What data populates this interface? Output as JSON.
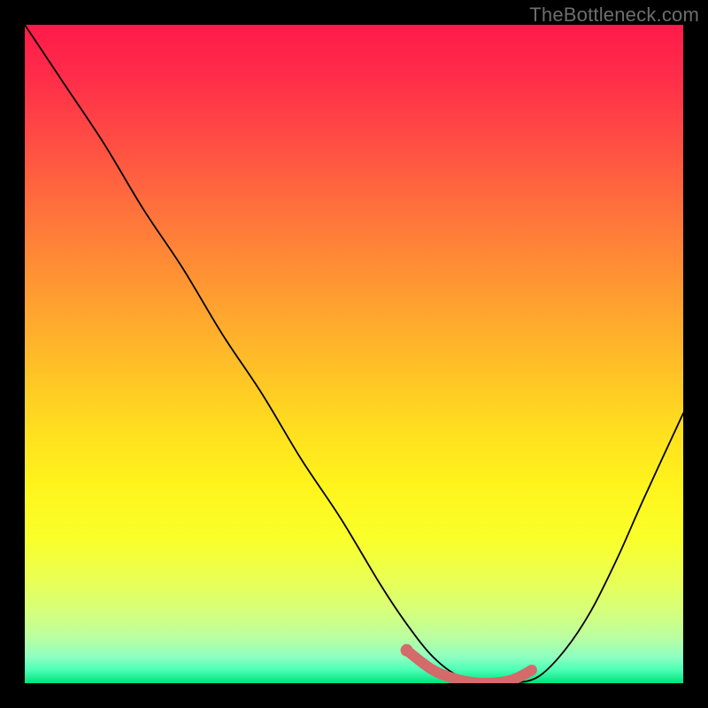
{
  "watermark": "TheBottleneck.com",
  "chart_data": {
    "type": "line",
    "title": "",
    "xlabel": "",
    "ylabel": "",
    "xlim": [
      0,
      100
    ],
    "ylim": [
      0,
      100
    ],
    "grid": false,
    "series": [
      {
        "name": "bottleneck-curve",
        "x": [
          0,
          6,
          12,
          18,
          24,
          30,
          36,
          42,
          48,
          54,
          58,
          62,
          66,
          70,
          74,
          78,
          82,
          86,
          90,
          94,
          100
        ],
        "values": [
          100,
          91,
          82,
          72,
          63,
          53,
          44,
          34,
          25,
          15,
          9,
          4,
          1,
          0,
          0,
          1,
          5,
          11,
          19,
          28,
          41
        ]
      },
      {
        "name": "highlight-segment",
        "color": "#d46a6a",
        "x": [
          58,
          62,
          66,
          70,
          74,
          77
        ],
        "values": [
          5,
          2,
          0.5,
          0,
          0.5,
          2
        ]
      }
    ],
    "annotations": []
  }
}
